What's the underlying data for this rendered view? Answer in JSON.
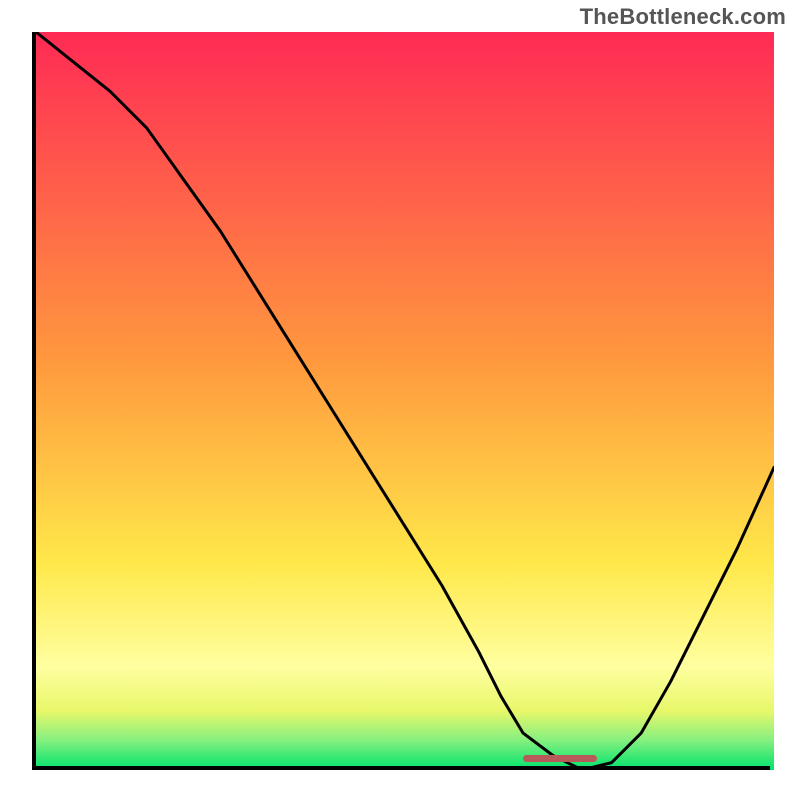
{
  "watermark": "TheBottleneck.com",
  "colors": {
    "red": "#ff2a55",
    "orange": "#ff9a3e",
    "yellow_mid": "#ffe84a",
    "yellow_green": "#e8f76a",
    "bright_green": "#84f07f",
    "green": "#00e26d",
    "marker": "#b85a5a",
    "axis": "#000000"
  },
  "chart_data": {
    "type": "line",
    "title": "",
    "xlabel": "",
    "ylabel": "",
    "xlim": [
      0,
      100
    ],
    "ylim": [
      0,
      100
    ],
    "x": [
      0,
      5,
      10,
      15,
      20,
      25,
      30,
      35,
      40,
      45,
      50,
      55,
      60,
      63,
      66,
      70,
      74,
      78,
      82,
      86,
      90,
      95,
      100
    ],
    "values": [
      100,
      96,
      92,
      87,
      80,
      73,
      65,
      57,
      49,
      41,
      33,
      25,
      16,
      10,
      5,
      2,
      0,
      1,
      5,
      12,
      20,
      30,
      41
    ],
    "background_gradient_stops": [
      {
        "pos": 0.0,
        "color": "#ff2a55"
      },
      {
        "pos": 0.45,
        "color": "#ff9a3e"
      },
      {
        "pos": 0.72,
        "color": "#ffe84a"
      },
      {
        "pos": 0.86,
        "color": "#ffffa0"
      },
      {
        "pos": 0.92,
        "color": "#e8f76a"
      },
      {
        "pos": 0.96,
        "color": "#84f07f"
      },
      {
        "pos": 1.0,
        "color": "#00e26d"
      }
    ],
    "marker_band": {
      "x_start": 66,
      "x_end": 76,
      "y": 0
    }
  }
}
